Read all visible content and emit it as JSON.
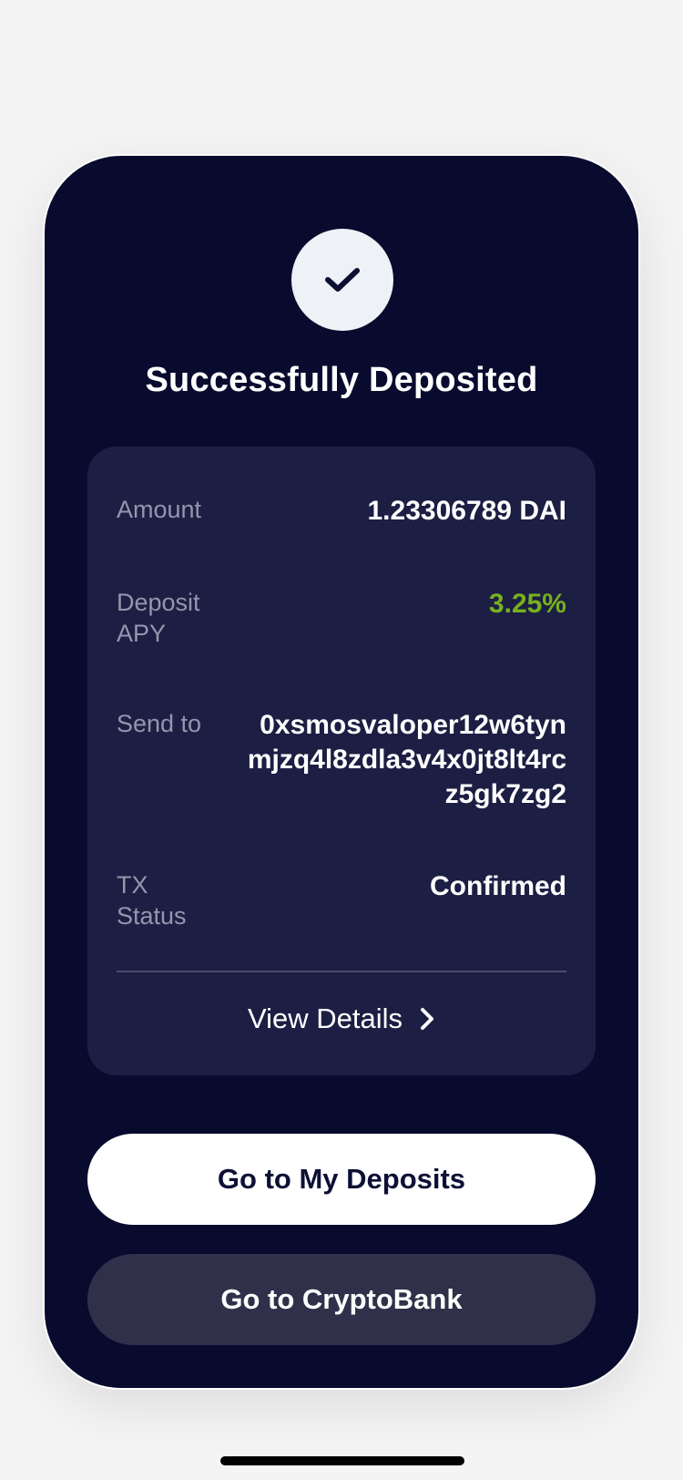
{
  "modal": {
    "title": "Successfully Deposited"
  },
  "details": {
    "rows": [
      {
        "label": "Amount",
        "value": "1.23306789 DAI"
      },
      {
        "label": "Deposit APY",
        "value": "3.25%"
      },
      {
        "label": "Send to",
        "value": "0xsmosvaloper12w6tynmjzq4l8zdla3v4x0jt8lt4rcz5gk7zg2"
      },
      {
        "label": "TX Status",
        "value": "Confirmed"
      }
    ],
    "view_details_label": "View Details"
  },
  "actions": {
    "primary_label": "Go to My Deposits",
    "secondary_label": "Go to CryptoBank"
  },
  "colors": {
    "card_bg": "#080b2e",
    "panel_bg": "#1c1e43",
    "apy_accent": "#77b11e",
    "secondary_button_bg": "#30304a"
  },
  "icons": {
    "success": "check-icon",
    "view_details": "chevron-right-icon"
  }
}
